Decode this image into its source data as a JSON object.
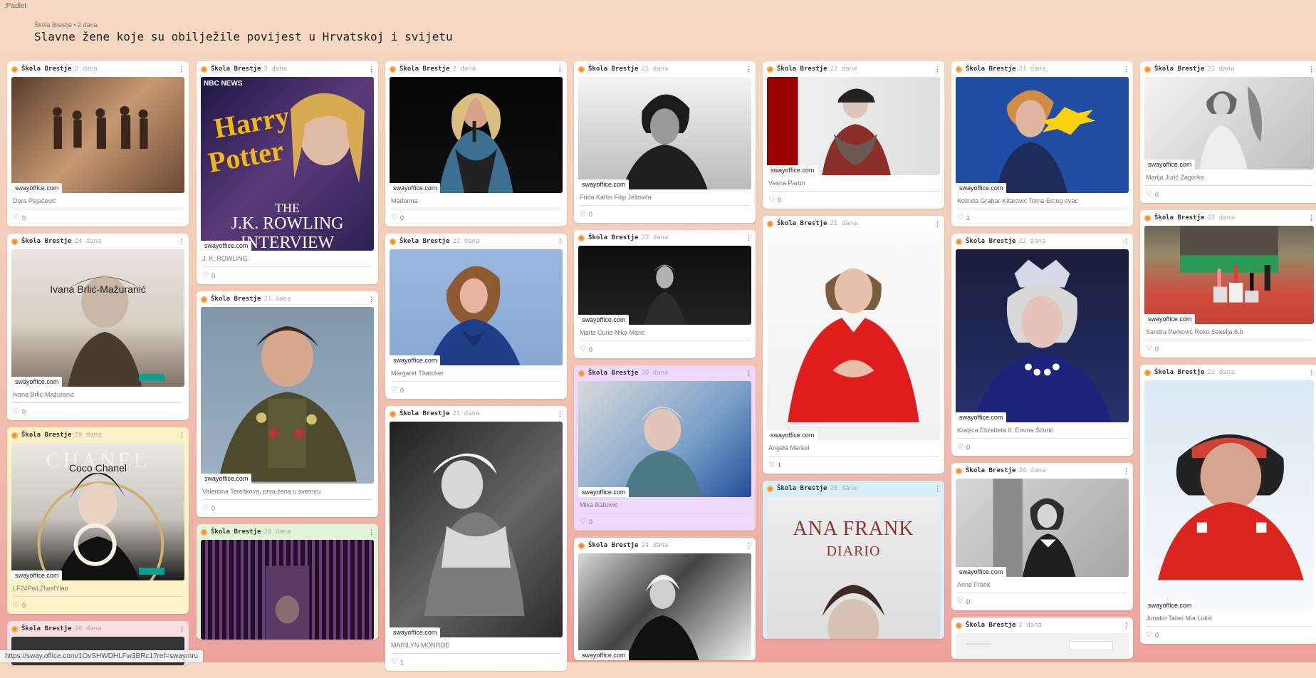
{
  "app": {
    "brand": ":Padlet",
    "board_meta": "Škola Brestje • 2 dana",
    "title": "Slavne žene koje su obilježile povijest u Hrvatskoj i svijetu"
  },
  "cards": {
    "c1": {
      "author": "Škola Brestje",
      "time": "2 dana",
      "caption": "Dora Pejačević",
      "likes": "0",
      "source": "swayoffice.com"
    },
    "c2": {
      "author": "Škola Brestje",
      "time": "24 dana",
      "caption": "Ivana Brlić-Mažuranić",
      "likes": "0",
      "source": "swayoffice.com",
      "overlay": "Ivana Brlić-Mažuranić"
    },
    "c3": {
      "author": "Škola Brestje",
      "time": "20 dana",
      "caption": "LF24PwLZIwxfYlao",
      "likes": "0",
      "source": "swayoffice.com",
      "overlay": "Coco Chanel",
      "watermark": "CHANEL"
    },
    "c4": {
      "author": "Škola Brestje",
      "time": "20 dana"
    },
    "c5": {
      "author": "Škola Brestje",
      "time": "2 dana",
      "caption": "J. K. ROWLING",
      "likes": "0",
      "source": "swayoffice.com",
      "news": "NBC NEWS",
      "book1": "Harry",
      "book2": "Potter",
      "interview1": "THE",
      "interview2": "J.K. ROWLING",
      "interview3": "INTERVIEW"
    },
    "c6": {
      "author": "Škola Brestje",
      "time": "21 dana",
      "caption": "Valentina Tereškova, prva žena u svemiru",
      "likes": "0",
      "source": "swayoffice.com"
    },
    "c7": {
      "author": "Škola Brestje",
      "time": "20 dana"
    },
    "c8": {
      "author": "Škola Brestje",
      "time": "2 dana",
      "caption": "Madonna",
      "likes": "0",
      "source": "swayoffice.com"
    },
    "c9": {
      "author": "Škola Brestje",
      "time": "22 dana",
      "caption": "Margaret Thatcher",
      "likes": "0",
      "source": "swayoffice.com"
    },
    "c10": {
      "author": "Škola Brestje",
      "time": "21 dana",
      "caption": "MARILYN MONROE",
      "likes": "1",
      "source": "swayoffice.com"
    },
    "c11": {
      "author": "Škola Brestje",
      "time": "21 dana",
      "caption": "Frida Kahlo Filip Ježovita",
      "likes": "0",
      "source": "swayoffice.com"
    },
    "c12": {
      "author": "Škola Brestje",
      "time": "22 dana",
      "caption": "Marie Curie Nika Marić",
      "likes": "0",
      "source": "swayoffice.com"
    },
    "c13": {
      "author": "Škola Brestje",
      "time": "20 dana",
      "caption": "Mika Babović",
      "likes": "0",
      "source": "swayoffice.com"
    },
    "c14": {
      "author": "Škola Brestje",
      "time": "24 dana",
      "source": "swayoffice.com"
    },
    "c15": {
      "author": "Škola Brestje",
      "time": "22 dana",
      "caption": "Vesna Parun",
      "likes": "0",
      "source": "swayoffice.com"
    },
    "c16": {
      "author": "Škola Brestje",
      "time": "21 dana",
      "caption": "Angela Merkel",
      "likes": "1",
      "source": "swayoffice.com"
    },
    "c17": {
      "author": "Škola Brestje",
      "time": "20 dana",
      "book1": "ANA FRANK",
      "book2": "DIARIO"
    },
    "c18": {
      "author": "Škola Brestje",
      "time": "21 dana",
      "caption": "Kolinda Grabar-Kitarović Toma Erceg ovac",
      "likes": "1",
      "source": "swayoffice.com"
    },
    "c19": {
      "author": "Škola Brestje",
      "time": "22 dana",
      "caption": "Kraljica Elizabeta II. Emma Šćurić",
      "likes": "0",
      "source": "swayoffice.com"
    },
    "c20": {
      "author": "Škola Brestje",
      "time": "24 dana",
      "caption": "Anne Frank",
      "likes": "0",
      "source": "swayoffice.com"
    },
    "c21": {
      "author": "Škola Brestje",
      "time": "2 dana"
    },
    "c22": {
      "author": "Škola Brestje",
      "time": "21 dana",
      "caption": "Marija Jurić Zagorka",
      "likes": "0",
      "source": "swayoffice.com"
    },
    "c23": {
      "author": "Škola Brestje",
      "time": "22 dana",
      "caption": "Sandra Perković Roko Sekelja 8.b",
      "likes": "0",
      "source": "swayoffice.com"
    },
    "c24": {
      "author": "Škola Brestje",
      "time": "22 dana",
      "caption": "Junako Tabei Mia Lukić",
      "likes": "0",
      "source": "swayoffice.com"
    }
  },
  "statusbar": {
    "url": "https://sway.office.com/1OvSHWDHLFw3BRc1?ref=swaymru"
  }
}
